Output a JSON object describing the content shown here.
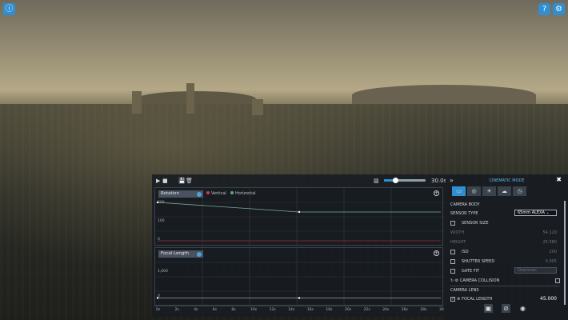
{
  "top_buttons": {
    "settings_icon": "gear-icon",
    "help_icon": "question-icon",
    "info_icon": "info-icon"
  },
  "timeline": {
    "duration": "30.0s",
    "slider_fraction": 0.15,
    "ticks": [
      "0s",
      "2s",
      "4s",
      "6s",
      "8s",
      "10s",
      "12s",
      "14s",
      "16s",
      "18s",
      "20s",
      "22s",
      "24s",
      "26s",
      "28s",
      "30"
    ]
  },
  "rotation": {
    "label": "Rotation",
    "legend": [
      {
        "name": "Vertical",
        "color": "#d9384f"
      },
      {
        "name": "Horizontal",
        "color": "#5fa878"
      }
    ],
    "y_ticks": [
      "200",
      "100",
      "0"
    ],
    "ylim": [
      0,
      200
    ],
    "horizontal_points": [
      [
        0,
        200
      ],
      [
        15,
        150
      ],
      [
        30,
        150
      ]
    ],
    "vertical_points": [
      [
        0,
        0
      ],
      [
        30,
        0
      ]
    ]
  },
  "focal": {
    "label": "Focal Length",
    "y_ticks": [
      "1,000",
      "0"
    ],
    "ylim": [
      0,
      1000
    ],
    "points": [
      [
        0,
        45
      ],
      [
        15,
        45
      ],
      [
        30,
        45
      ]
    ]
  },
  "side": {
    "title": "CINEMATIC MODE",
    "section_body": "CAMERA BODY",
    "sensor_type_label": "SENSOR TYPE",
    "sensor_type": "65mm ALEXA",
    "sensor_size": "SENSOR SIZE",
    "width_label": "WIDTH",
    "width": "54.120",
    "height_label": "HEIGHT",
    "height": "25.580",
    "iso_label": "ISO",
    "iso": "200",
    "shutter_label": "SHUTTER SPEED",
    "shutter": "0.005",
    "gate_label": "GATE FIT",
    "gate": "Overscan",
    "collision": "CAMERA COLLISION",
    "section_lens": "CAMERA LENS",
    "focal_label": "FOCAL LENGTH",
    "focal": "45.000"
  }
}
